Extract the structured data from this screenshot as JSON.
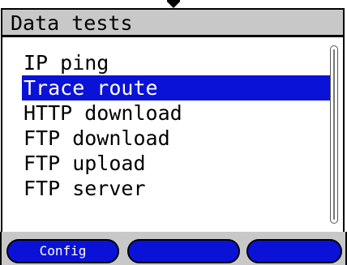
{
  "header": {
    "title": "Data tests"
  },
  "menu": {
    "items": [
      {
        "label": "IP ping"
      },
      {
        "label": "Trace route"
      },
      {
        "label": "HTTP download"
      },
      {
        "label": "FTP download"
      },
      {
        "label": "FTP upload"
      },
      {
        "label": "FTP server"
      }
    ],
    "selected_label": "Trace route"
  },
  "softkeys": [
    {
      "label": "Config"
    },
    {
      "label": ""
    },
    {
      "label": ""
    }
  ],
  "colors": {
    "selection": "#0b12d8",
    "titlebar": "#c8c8c8",
    "softkey": "#0b12d8"
  },
  "icons": {
    "top_indicator": "down-arrow-icon"
  }
}
